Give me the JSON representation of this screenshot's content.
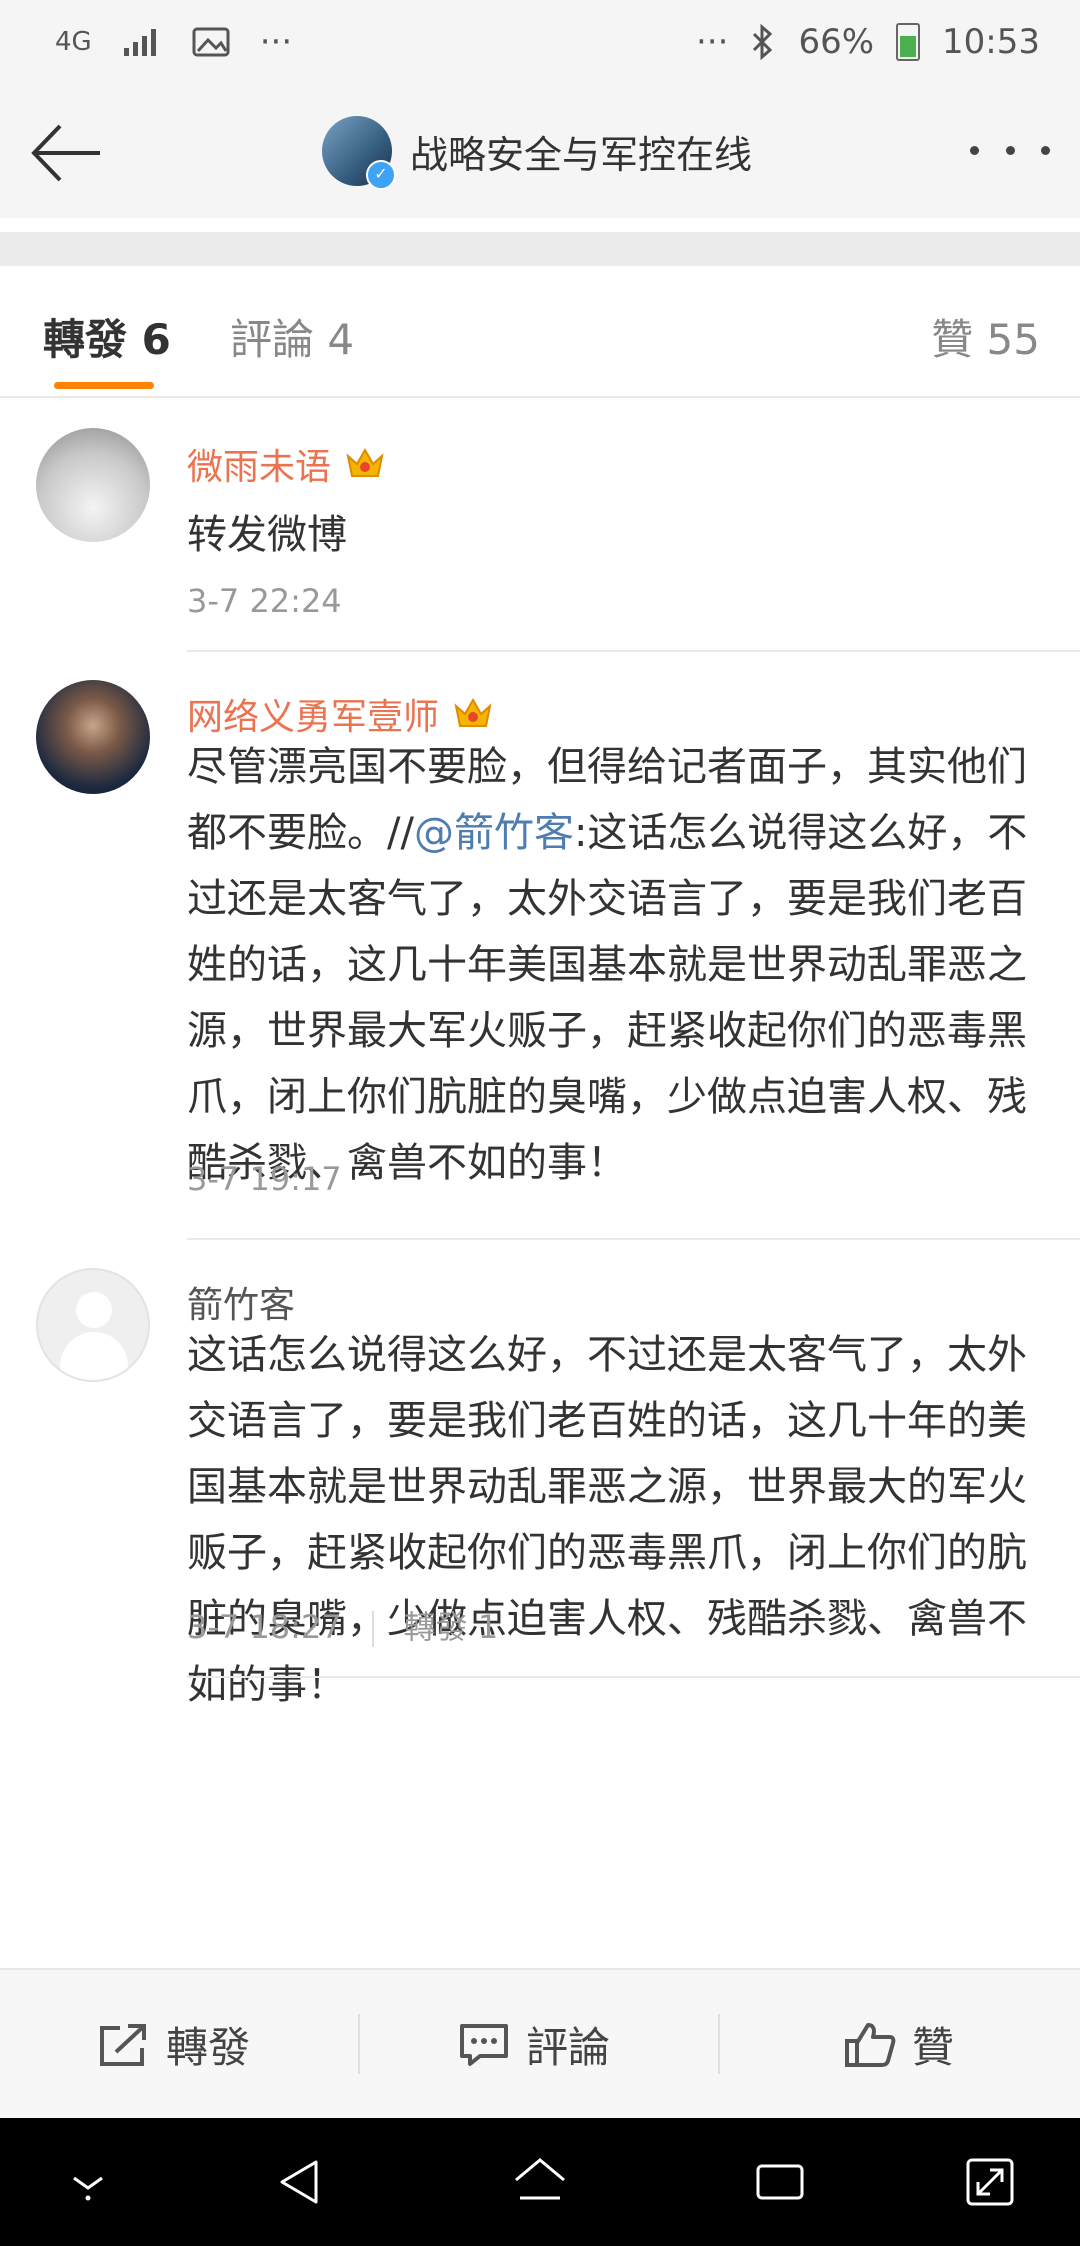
{
  "status_bar": {
    "network": "4G",
    "overflow_left": "···",
    "overflow_right": "···",
    "battery_percent": "66%",
    "time": "10:53",
    "icons": [
      "network-4g-icon",
      "signal-icon",
      "image-icon",
      "bluetooth-icon",
      "battery-icon"
    ]
  },
  "header": {
    "title": "战略安全与军控在线",
    "verified": true
  },
  "tabs": {
    "repost": "轉發 6",
    "comment": "評論 4",
    "likes": "贊 55"
  },
  "colors": {
    "accent": "#ff8200",
    "username": "#eb7350",
    "mention": "#507daf"
  },
  "feed": [
    {
      "username": "微雨未语",
      "vip_crown": true,
      "content": "转发微博",
      "time": "3-7 22:24"
    },
    {
      "username": "网络义勇军壹师",
      "vip_crown": true,
      "content_before": "尽管漂亮国不要脸，但得给记者面子，其实他们都不要脸。//",
      "mention": "@箭竹客",
      "content_after": ":这话怎么说得这么好，不过还是太客气了，太外交语言了，要是我们老百姓的话，这几十年美国基本就是世界动乱罪恶之源，世界最大军火贩子，赶紧收起你们的恶毒黑爪，闭上你们肮脏的臭嘴，少做点迫害人权、残酷杀戮、禽兽不如的事！",
      "time": "3-7 19:17"
    },
    {
      "username": "箭竹客",
      "vip_crown": false,
      "content": "这话怎么说得这么好，不过还是太客气了，太外交语言了，要是我们老百姓的话，这几十年的美国基本就是世界动乱罪恶之源，世界最大的军火贩子，赶紧收起你们的恶毒黑爪，闭上你们的肮脏的臭嘴，少做点迫害人权、残酷杀戮、禽兽不如的事！",
      "time": "3-7 18:27",
      "repost_count": "轉發 1"
    }
  ],
  "actions": {
    "repost": "轉發",
    "comment": "評論",
    "like": "贊"
  }
}
